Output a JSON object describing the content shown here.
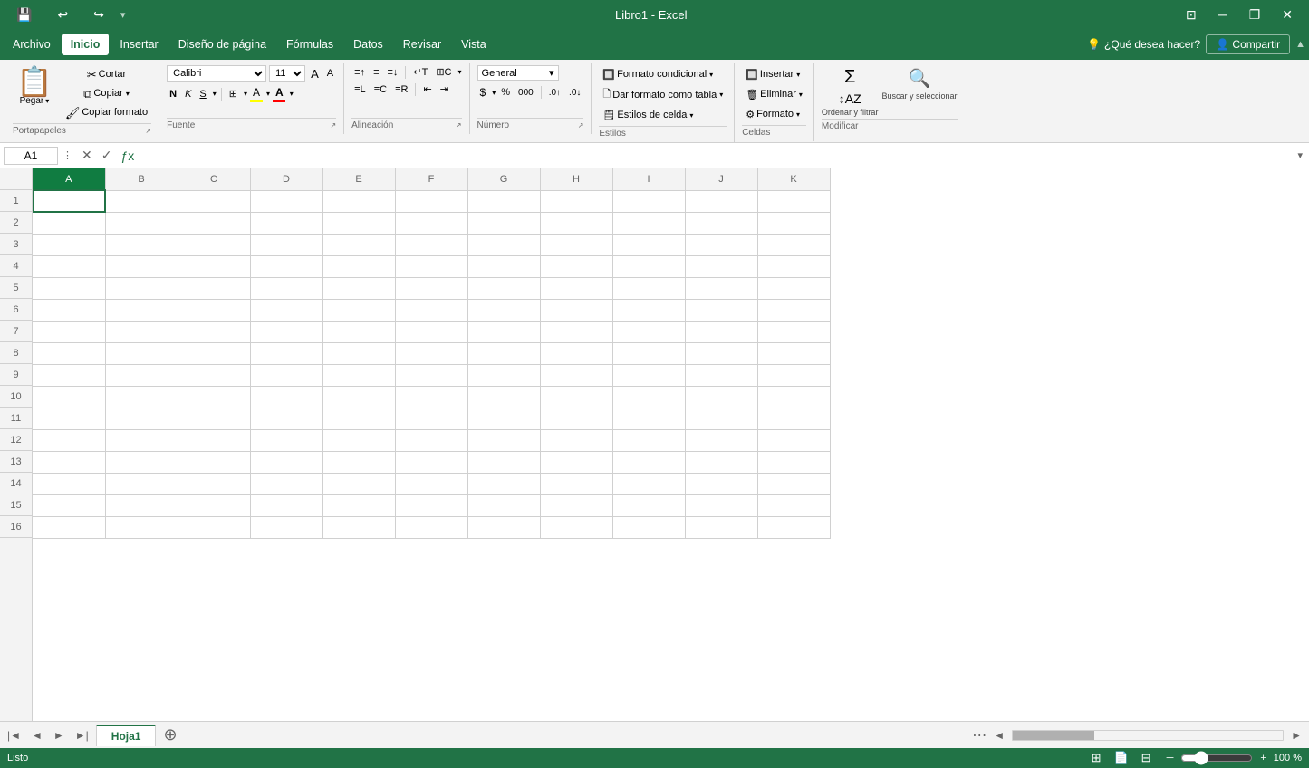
{
  "titlebar": {
    "title": "Libro1 - Excel",
    "save_icon": "💾",
    "undo_icon": "↩",
    "redo_icon": "↪",
    "minimize_icon": "─",
    "restore_icon": "❐",
    "close_icon": "✕",
    "extra_icon": "⊡"
  },
  "menubar": {
    "items": [
      {
        "id": "archivo",
        "label": "Archivo",
        "active": false
      },
      {
        "id": "inicio",
        "label": "Inicio",
        "active": true
      },
      {
        "id": "insertar",
        "label": "Insertar",
        "active": false
      },
      {
        "id": "diseno",
        "label": "Diseño de página",
        "active": false
      },
      {
        "id": "formulas",
        "label": "Fórmulas",
        "active": false
      },
      {
        "id": "datos",
        "label": "Datos",
        "active": false
      },
      {
        "id": "revisar",
        "label": "Revisar",
        "active": false
      },
      {
        "id": "vista",
        "label": "Vista",
        "active": false
      }
    ],
    "search_placeholder": "¿Qué desea hacer?",
    "share_label": "Compartir"
  },
  "ribbon": {
    "groups": [
      {
        "id": "portapapeles",
        "label": "Portapapeles",
        "buttons": [
          "Pegar",
          "Cortar",
          "Copiar",
          "Copiar formato"
        ]
      },
      {
        "id": "fuente",
        "label": "Fuente",
        "font": "Calibri",
        "size": "11"
      },
      {
        "id": "alineacion",
        "label": "Alineación"
      },
      {
        "id": "numero",
        "label": "Número",
        "format": "General"
      },
      {
        "id": "estilos",
        "label": "Estilos"
      },
      {
        "id": "celdas",
        "label": "Celdas"
      },
      {
        "id": "modificar",
        "label": "Modificar"
      }
    ]
  },
  "formula_bar": {
    "cell_ref": "A1",
    "formula": ""
  },
  "columns": [
    "A",
    "B",
    "C",
    "D",
    "E",
    "F",
    "G",
    "H",
    "I",
    "J",
    "K"
  ],
  "rows": [
    1,
    2,
    3,
    4,
    5,
    6,
    7,
    8,
    9,
    10,
    11,
    12,
    13,
    14,
    15,
    16
  ],
  "active_cell": "A1",
  "sheet_tabs": [
    {
      "id": "hoja1",
      "label": "Hoja1",
      "active": true
    }
  ],
  "statusbar": {
    "status": "Listo",
    "zoom": "100 %"
  }
}
